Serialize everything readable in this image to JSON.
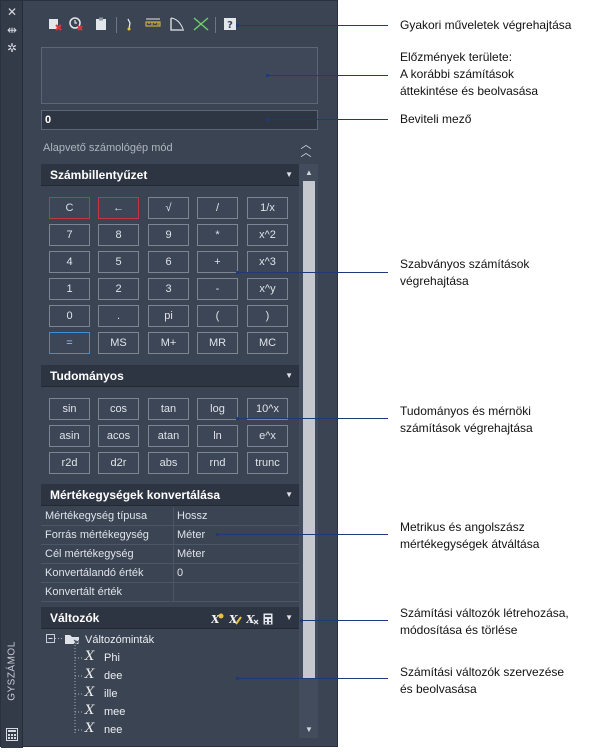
{
  "palette": {
    "vertical_title": "GYSZÁMOL",
    "strip_icons": [
      "close-icon",
      "dock-icon",
      "settings-icon",
      "calculator-icon"
    ],
    "toolbar_icons": [
      "clear-icon",
      "clear-history-icon",
      "paste-icon",
      "get-coordinates-icon",
      "distance-icon",
      "angle-icon",
      "intersection-icon",
      "help-icon"
    ],
    "input_value": "0",
    "mode_label": "Alapvető számológép mód",
    "keypad": {
      "title": "Számbillentyűzet",
      "rows": [
        [
          "C",
          "←",
          "√",
          "/",
          "1/x"
        ],
        [
          "7",
          "8",
          "9",
          "*",
          "x^2"
        ],
        [
          "4",
          "5",
          "6",
          "+",
          "x^3"
        ],
        [
          "1",
          "2",
          "3",
          "-",
          "x^y"
        ],
        [
          "0",
          ".",
          "pi",
          "(",
          ")"
        ],
        [
          "=",
          "MS",
          "M+",
          "MR",
          "MC"
        ]
      ]
    },
    "scientific": {
      "title": "Tudományos",
      "rows": [
        [
          "sin",
          "cos",
          "tan",
          "log",
          "10^x"
        ],
        [
          "asin",
          "acos",
          "atan",
          "ln",
          "e^x"
        ],
        [
          "r2d",
          "d2r",
          "abs",
          "rnd",
          "trunc"
        ]
      ]
    },
    "units": {
      "title": "Mértékegységek konvertálása",
      "rows": [
        {
          "label": "Mértékegység típusa",
          "value": "Hossz"
        },
        {
          "label": "Forrás mértékegység",
          "value": "Méter"
        },
        {
          "label": "Cél mértékegység",
          "value": "Méter"
        },
        {
          "label": "Konvertálandó érték",
          "value": "0"
        },
        {
          "label": "Konvertált érték",
          "value": ""
        }
      ]
    },
    "variables": {
      "title": "Változók",
      "header_icons": [
        "new-variable-icon",
        "edit-variable-icon",
        "delete-variable-icon",
        "calculator-icon"
      ],
      "folder": "Változóminták",
      "items": [
        "Phi",
        "dee",
        "ille",
        "mee",
        "nee"
      ]
    }
  },
  "callouts": [
    "Gyakori műveletek végrehajtása",
    "Előzmények területe:\nA korábbi számítások\náttekintése és beolvasása",
    "Beviteli mező",
    "Szabványos számítások\nvégrehajtása",
    "Tudományos és mérnöki\nszámítások végrehajtása",
    "Metrikus és angolszász\nmértékegységek átváltása",
    "Számítási változók létrehozása,\nmódosítása és törlése",
    "Számítási változók szervezése\nés beolvasása"
  ]
}
